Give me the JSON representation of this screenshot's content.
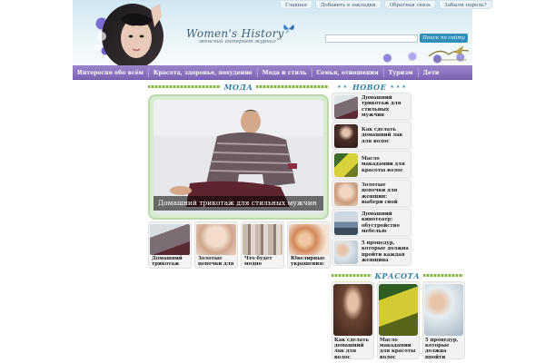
{
  "header": {
    "logo_main": "Women's History",
    "logo_sub": "женский интернет журнал",
    "top_links": [
      "Главная",
      "Добавить в закладки",
      "Обратная связь",
      "Забыли пароль?"
    ],
    "search_placeholder": "",
    "search_button": "Поиск по сайту"
  },
  "nav": {
    "items": [
      "Интересно обо всём",
      "Красота, здоровье, похудение",
      "Мода и стиль",
      "Семья, отношения",
      "Туризм",
      "Дети"
    ]
  },
  "sections": {
    "moda": "МОДА",
    "novoe": "НОВОЕ",
    "krasota": "КРАСОТА"
  },
  "featured": {
    "caption": "Домашний трикотаж для стильных мужчин"
  },
  "thumbs": [
    {
      "label": "Домашний трикотаж для",
      "color": "#8f7e84"
    },
    {
      "label": "Золотые цепочки для",
      "color": "#e8c9b2"
    },
    {
      "label": "Что будет модно носить",
      "color": "#b9a89c"
    },
    {
      "label": "Ювелирные украшения:",
      "color": "#e8b48e"
    }
  ],
  "new_items": [
    {
      "label": "Домашний трикотаж для стильных мужчин",
      "color": "#7b6b73"
    },
    {
      "label": "Как сделать домашний лак для волос",
      "color": "#5a3d33"
    },
    {
      "label": "Масло макадамии для красоты волос",
      "color": "#c9c13a"
    },
    {
      "label": "Золотые цепочки для женщин: выбери свой",
      "color": "#d9b89e"
    },
    {
      "label": "Домашний кинотеатр: обустройство мебелью",
      "color": "#8aa0b4"
    },
    {
      "label": "5 процедур, которые должна пройти каждая женщина",
      "color": "#c7d3dc"
    }
  ],
  "beauty": [
    {
      "label": "Как сделать домашний лак для волос",
      "color": "#5b3a2e"
    },
    {
      "label": "Масло макадамии для красоты волос",
      "color": "#b8b12f"
    },
    {
      "label": "5 процедур, которые должна пройти каждая",
      "color": "#c9d4dc"
    }
  ]
}
